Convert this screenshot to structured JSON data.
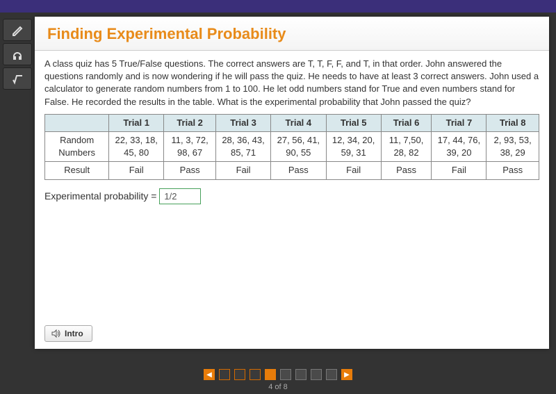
{
  "page": {
    "title": "Finding Experimental Probability",
    "problem_text": "A class quiz has 5 True/False questions. The correct answers are T, T, F, F, and T, in that order. John answered the questions randomly and is now wondering if he will pass the quiz. He needs to have at least 3 correct answers. John used a calculator to generate random numbers from 1 to 100. He let odd numbers stand for True and even numbers stand for False. He recorded the results in the table. What is the experimental probability that John passed the quiz?"
  },
  "table": {
    "row_headers": [
      "Random Numbers",
      "Result"
    ],
    "columns": [
      "Trial 1",
      "Trial 2",
      "Trial 3",
      "Trial 4",
      "Trial 5",
      "Trial 6",
      "Trial 7",
      "Trial 8"
    ],
    "random_numbers": [
      "22, 33, 18, 45, 80",
      "11, 3, 72, 98, 67",
      "28, 36, 43, 85, 71",
      "27, 56, 41, 90, 55",
      "12, 34, 20, 59, 31",
      "11, 7,50, 28, 82",
      "17, 44, 76, 39, 20",
      "2, 93, 53, 38, 29"
    ],
    "results": [
      "Fail",
      "Pass",
      "Fail",
      "Pass",
      "Fail",
      "Pass",
      "Fail",
      "Pass"
    ]
  },
  "answer": {
    "label": "Experimental probability =",
    "value": "1/2"
  },
  "buttons": {
    "intro": "Intro"
  },
  "pager": {
    "counter": "4 of 8",
    "current": 4,
    "total": 8
  }
}
